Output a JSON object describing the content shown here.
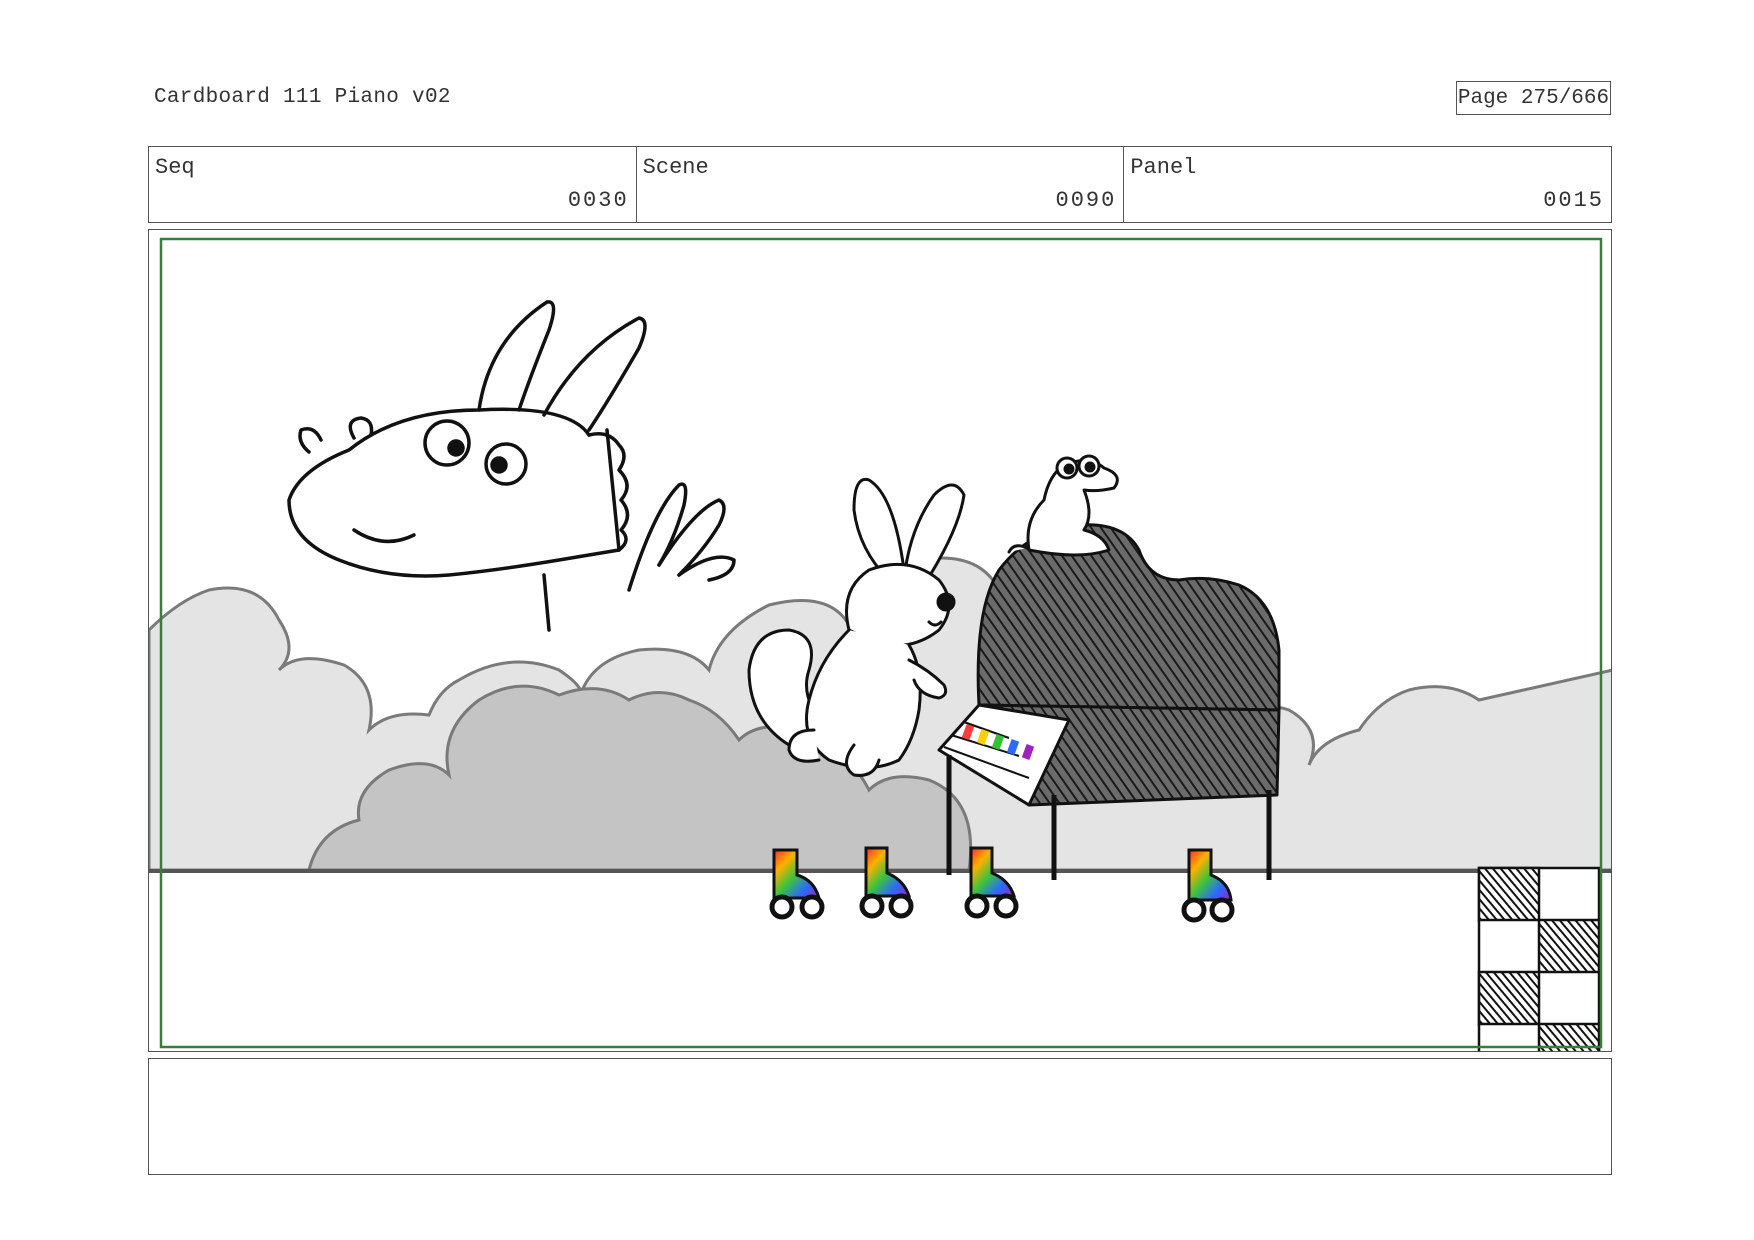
{
  "header": {
    "title": "Cardboard 111 Piano v02",
    "page": "Page 275/666"
  },
  "fields": [
    {
      "label": "Seq",
      "value": "0030"
    },
    {
      "label": "Scene",
      "value": "0090"
    },
    {
      "label": "Panel",
      "value": "0015"
    }
  ],
  "notes": "",
  "colors": {
    "safe_frame": "#3a7d3a",
    "cloud_fill": "#cfcfcf",
    "cloud_line": "#7a7a7a"
  }
}
